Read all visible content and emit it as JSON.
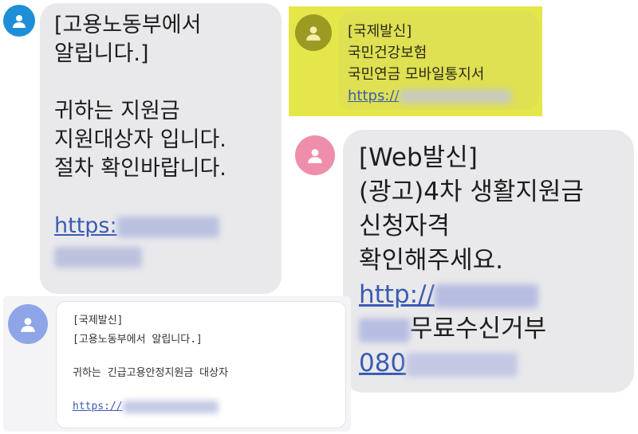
{
  "colors": {
    "link": "#3b5bb3",
    "bubble_gray": "#e9e9ec",
    "highlight_yellow": "#e4e64a",
    "avatar_blue": "#1e8fd6",
    "avatar_olive": "#9d9a24",
    "avatar_pink": "#ef8eaa",
    "avatar_periwinkle": "#8ea6e8"
  },
  "messages": [
    {
      "avatar_icon": "person-icon",
      "lines": [
        "[고용노동부에서",
        "알립니다.]",
        "귀하는 지원금",
        "지원대상자 입니다.",
        "절차 확인바랍니다."
      ],
      "link_prefix": "https:"
    },
    {
      "avatar_icon": "person-icon",
      "lines": [
        "[국제발신]",
        "국민건강보험",
        "국민연금 모바일통지서"
      ],
      "link_prefix": "https://"
    },
    {
      "avatar_icon": "person-icon",
      "lines": [
        "[Web발신]",
        "(광고)4차 생활지원금",
        "신청자격",
        "확인해주세요."
      ],
      "link_prefix": "http://",
      "optout_text": "무료수신거부",
      "phone_prefix": "080"
    },
    {
      "avatar_icon": "person-icon",
      "lines": [
        "[국제발신]",
        "[고용노동부에서 알립니다.]",
        "귀하는 긴급고용안정지원금 대상자"
      ],
      "link_prefix": "https://"
    }
  ]
}
